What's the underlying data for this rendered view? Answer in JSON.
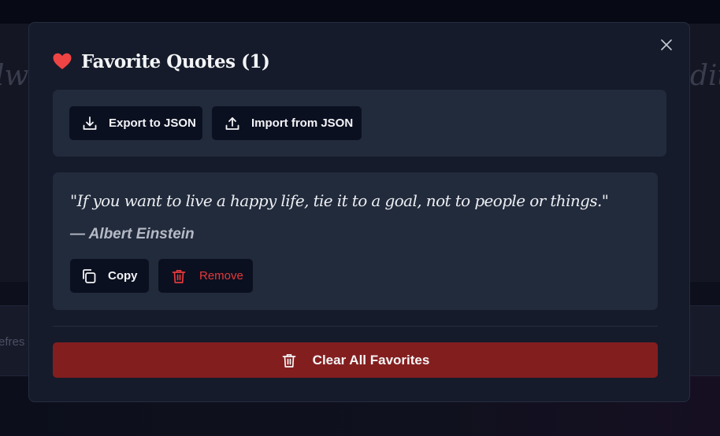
{
  "background": {
    "ghost_left": "lwo",
    "ghost_right": "dit",
    "side_text": "efres"
  },
  "modal": {
    "title": "Favorite Quotes (1)",
    "icons": {
      "title": "heart-icon",
      "close": "close-icon"
    }
  },
  "actions": {
    "export_label": "Export to JSON",
    "import_label": "Import from JSON",
    "icons": {
      "export": "download-icon",
      "import": "upload-icon"
    }
  },
  "favorites": [
    {
      "text": "\"If you want to live a happy life, tie it to a goal, not to people or things.\"",
      "author": "— Albert Einstein",
      "copy_label": "Copy",
      "remove_label": "Remove"
    }
  ],
  "clear_all_label": "Clear All Favorites",
  "colors": {
    "accent_red": "#e5393a",
    "danger_button": "#831e1f",
    "panel": "#222b3b",
    "modal": "#151b2a"
  }
}
